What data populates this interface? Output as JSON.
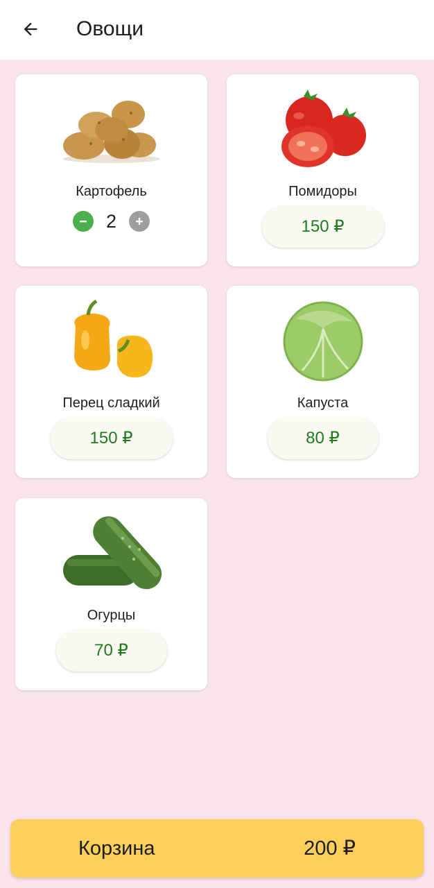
{
  "header": {
    "title": "Овощи",
    "back_icon": "arrow-left-icon"
  },
  "products": [
    {
      "name": "Картофель",
      "quantity": "2",
      "image_icon": "potato-image"
    },
    {
      "name": "Помидоры",
      "price": "150 ₽",
      "image_icon": "tomato-image"
    },
    {
      "name": "Перец сладкий",
      "price": "150 ₽",
      "image_icon": "bell-pepper-image"
    },
    {
      "name": "Капуста",
      "price": "80 ₽",
      "image_icon": "cabbage-image"
    },
    {
      "name": "Огурцы",
      "price": "70 ₽",
      "image_icon": "cucumber-image"
    }
  ],
  "cart": {
    "label": "Корзина",
    "total": "200 ₽"
  },
  "colors": {
    "background": "#F9E3EC",
    "price_text": "#1E7A1E",
    "cart_bar": "#FCCF5C",
    "minus_button": "#4CAF50",
    "plus_button": "#9E9E9E"
  }
}
